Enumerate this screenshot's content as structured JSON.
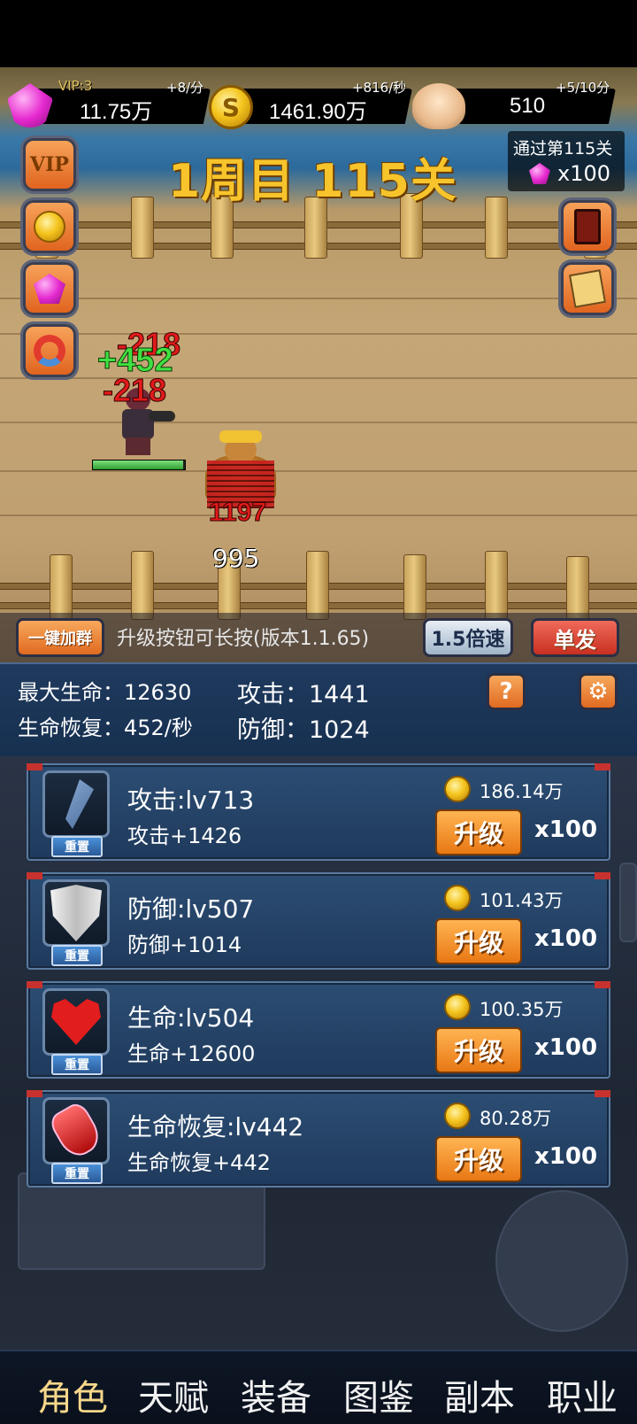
{
  "resources": {
    "gems": {
      "vip": "VIP:3",
      "value": "11.75万",
      "rate": "+8/分"
    },
    "coins": {
      "value": "1461.90万",
      "rate": "+816/秒"
    },
    "skulls": {
      "value": "510",
      "rate": "+5/10分"
    }
  },
  "level": {
    "title": "1周目 115关",
    "reward_text": "通过第115关",
    "reward_count": "x100"
  },
  "side_buttons": {
    "vip_label": "VIP"
  },
  "battle": {
    "floats": [
      "-218",
      "+452",
      "-218",
      "1197"
    ],
    "boss_hp": "995",
    "hero_hp_fraction": 0.98
  },
  "controls": {
    "group_button": "一键加群",
    "hint": "升级按钮可长按(版本1.1.65)",
    "speed_button": "1.5倍速",
    "single_button": "单发"
  },
  "stats": {
    "max_hp": {
      "label": "最大生命：",
      "value": "12630"
    },
    "attack": {
      "label": "攻击：",
      "value": "1441"
    },
    "regen": {
      "label": "生命恢复：",
      "value": "452/秒"
    },
    "defense": {
      "label": "防御：",
      "value": "1024"
    },
    "help_glyph": "?",
    "settings_glyph": "⚙"
  },
  "upgrades": [
    {
      "title": "攻击:lv713",
      "bonus": "攻击+1426",
      "cost": "186.14万",
      "button": "升级",
      "mult": "x100",
      "reset": "重置"
    },
    {
      "title": "防御:lv507",
      "bonus": "防御+1014",
      "cost": "101.43万",
      "button": "升级",
      "mult": "x100",
      "reset": "重置"
    },
    {
      "title": "生命:lv504",
      "bonus": "生命+12600",
      "cost": "100.35万",
      "button": "升级",
      "mult": "x100",
      "reset": "重置"
    },
    {
      "title": "生命恢复:lv442",
      "bonus": "生命恢复+442",
      "cost": "80.28万",
      "button": "升级",
      "mult": "x100",
      "reset": "重置"
    }
  ],
  "nav": [
    "角色",
    "天赋",
    "装备",
    "图鉴",
    "副本",
    "职业"
  ],
  "colors": {
    "accent_orange": "#e06a20",
    "title_gold": "#f7c42c",
    "panel_blue": "#1f3a5c"
  }
}
